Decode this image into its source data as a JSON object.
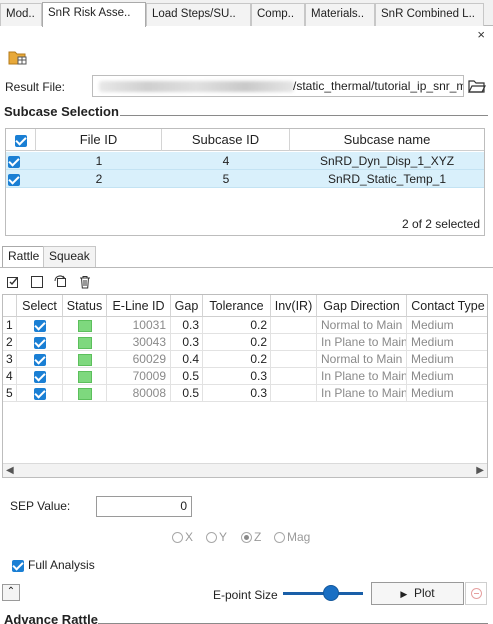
{
  "tabs": [
    {
      "label": "Mod.."
    },
    {
      "label": "SnR Risk Asse.."
    },
    {
      "label": "Load Steps/SU.."
    },
    {
      "label": "Comp.."
    },
    {
      "label": "Materials.."
    },
    {
      "label": "SnR Combined L.."
    }
  ],
  "close_label": "×",
  "result_file": {
    "label": "Result File:",
    "value": "/static_thermal/tutorial_ip_snr_m"
  },
  "subcase_selection": {
    "title": "Subcase Selection",
    "headers": [
      "File ID",
      "Subcase ID",
      "Subcase name"
    ],
    "rows": [
      {
        "file_id": "1",
        "subcase_id": "4",
        "name": "SnRD_Dyn_Disp_1_XYZ",
        "checked": true
      },
      {
        "file_id": "2",
        "subcase_id": "5",
        "name": "SnRD_Static_Temp_1",
        "checked": true
      }
    ],
    "footer": "2 of 2 selected"
  },
  "inner_tabs": [
    "Rattle",
    "Squeak"
  ],
  "toolbar_icons": [
    "check-all-icon",
    "uncheck-all-icon",
    "refresh-icon",
    "delete-icon"
  ],
  "rattle_table": {
    "headers": [
      "",
      "Select",
      "Status",
      "E-Line ID",
      "Gap",
      "Tolerance",
      "Inv(IR)",
      "Gap Direction",
      "Contact Type"
    ],
    "rows": [
      {
        "n": "1",
        "eline": "10031",
        "gap": "0.3",
        "tol": "0.2",
        "inv": "",
        "dir": "Normal to Main",
        "contact": "Medium"
      },
      {
        "n": "2",
        "eline": "30043",
        "gap": "0.3",
        "tol": "0.2",
        "inv": "",
        "dir": "In Plane to Main",
        "contact": "Medium"
      },
      {
        "n": "3",
        "eline": "60029",
        "gap": "0.4",
        "tol": "0.2",
        "inv": "",
        "dir": "Normal to Main",
        "contact": "Medium"
      },
      {
        "n": "4",
        "eline": "70009",
        "gap": "0.5",
        "tol": "0.3",
        "inv": "",
        "dir": "In Plane to Main",
        "contact": "Medium"
      },
      {
        "n": "5",
        "eline": "80008",
        "gap": "0.5",
        "tol": "0.3",
        "inv": "",
        "dir": "In Plane to Main",
        "contact": "Medium"
      }
    ],
    "status_color": "#7ed87e"
  },
  "sep": {
    "label": "SEP Value:",
    "value": "0"
  },
  "axis_options": {
    "x": "X",
    "y": "Y",
    "z": "Z",
    "mag": "Mag",
    "selected": "Z"
  },
  "full_analysis": {
    "label": "Full Analysis",
    "checked": true
  },
  "epoint": {
    "label": "E-point Size",
    "level": 0.5
  },
  "plot_button": {
    "label": "Plot"
  },
  "advance_rattle": {
    "title": "Advance Rattle"
  },
  "colors": {
    "accent": "#1a7fd4",
    "row_highlight": "#d9f0fb"
  }
}
